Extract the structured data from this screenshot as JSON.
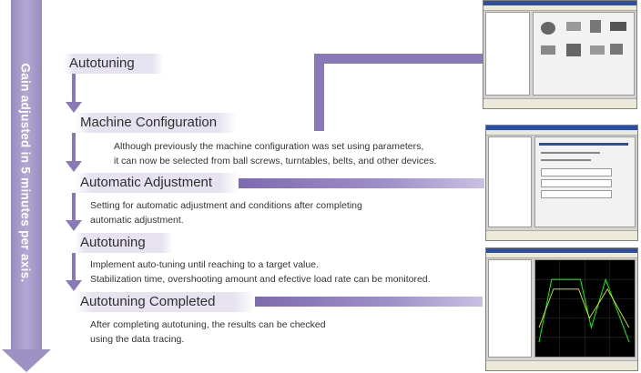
{
  "side_label": "Gain adjusted in 5 minutes per axis.",
  "steps": [
    {
      "title": "Autotuning"
    },
    {
      "title": "Machine Configuration",
      "desc": [
        "Although previously the machine configuration was set using parameters,",
        "it can now be selected from ball screws, turntables, belts, and other devices."
      ]
    },
    {
      "title": "Automatic Adjustment",
      "desc": [
        "Setting for automatic adjustment and conditions after completing",
        "automatic adjustment."
      ]
    },
    {
      "title": "Autotuning",
      "desc": [
        "Implement auto-tuning until reaching to a target value.",
        "Stabilization time, overshooting amount and efective load rate can be monitored."
      ]
    },
    {
      "title": "Autotuning Completed",
      "desc": [
        "After completing autotuning, the results can be checked",
        "using the data tracing."
      ]
    }
  ],
  "colors": {
    "accent": "#8a79b8",
    "band": "#e6e2f0",
    "trace_bg": "#000000",
    "trace_line": "#00ff00"
  }
}
